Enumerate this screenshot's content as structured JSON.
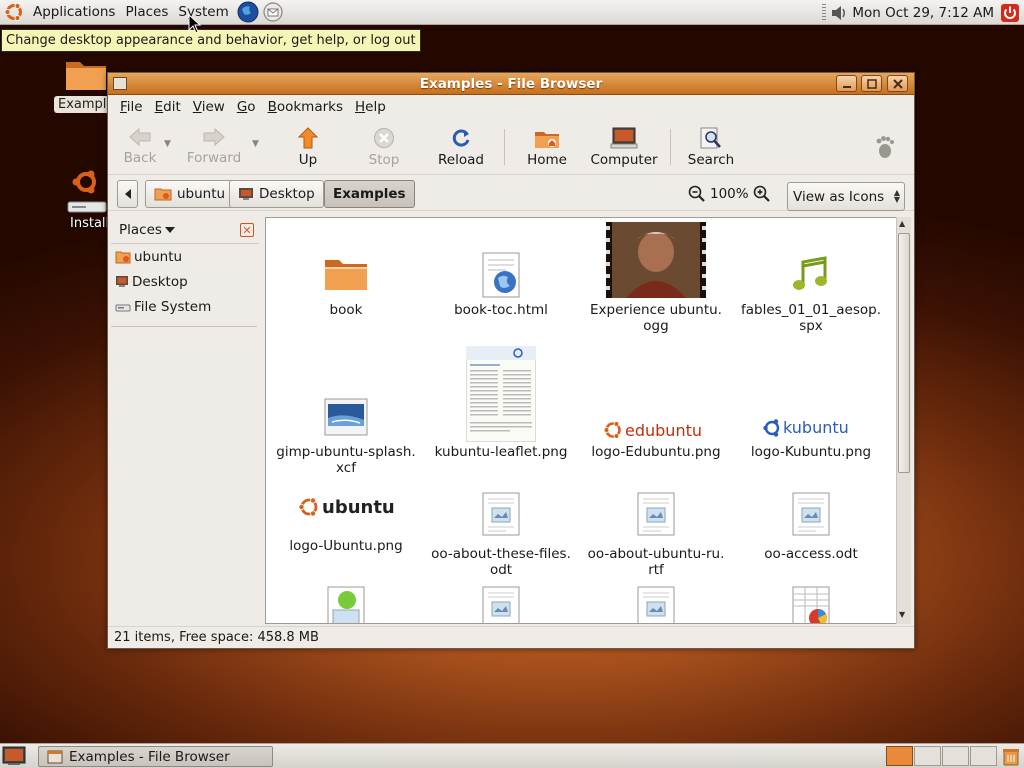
{
  "top_panel": {
    "menus": [
      "Applications",
      "Places",
      "System"
    ],
    "clock": "Mon Oct 29,  7:12 AM"
  },
  "tooltip": "Change desktop appearance and behavior, get help, or log out",
  "desktop": {
    "icons": [
      {
        "label": "Exampl"
      },
      {
        "label": "Install"
      }
    ]
  },
  "window": {
    "title": "Examples - File Browser",
    "menubar": [
      {
        "first": "F",
        "rest": "ile"
      },
      {
        "first": "E",
        "rest": "dit"
      },
      {
        "first": "V",
        "rest": "iew"
      },
      {
        "first": "G",
        "rest": "o"
      },
      {
        "first": "B",
        "rest": "ookmarks"
      },
      {
        "first": "H",
        "rest": "elp"
      }
    ],
    "toolbar": {
      "back": "Back",
      "forward": "Forward",
      "up": "Up",
      "stop": "Stop",
      "reload": "Reload",
      "home": "Home",
      "computer": "Computer",
      "search": "Search"
    },
    "location": {
      "path": [
        "ubuntu",
        "Desktop",
        "Examples"
      ],
      "zoom": "100%",
      "view_mode": "View as Icons"
    },
    "sidepane": {
      "title": "Places",
      "items": [
        "ubuntu",
        "Desktop",
        "File System"
      ]
    },
    "files": [
      {
        "line1": "book",
        "line2": ""
      },
      {
        "line1": "book-toc.html",
        "line2": ""
      },
      {
        "line1": "Experience ubuntu.",
        "line2": "ogg"
      },
      {
        "line1": "fables_01_01_aesop.",
        "line2": "spx"
      },
      {
        "line1": "gimp-ubuntu-splash.",
        "line2": "xcf"
      },
      {
        "line1": "kubuntu-leaflet.png",
        "line2": ""
      },
      {
        "line1": "logo-Edubuntu.png",
        "line2": ""
      },
      {
        "line1": "logo-Kubuntu.png",
        "line2": ""
      },
      {
        "line1": "logo-Ubuntu.png",
        "line2": ""
      },
      {
        "line1": "oo-about-these-files.",
        "line2": "odt"
      },
      {
        "line1": "oo-about-ubuntu-ru.",
        "line2": "rtf"
      },
      {
        "line1": "oo-access.odt",
        "line2": ""
      }
    ],
    "logo_text": {
      "edubuntu": "edubuntu",
      "kubuntu": "kubuntu",
      "ubuntu": "ubuntu"
    },
    "status": "21 items, Free space: 458.8 MB"
  },
  "bottom_panel": {
    "task": "Examples - File Browser",
    "workspaces": 4
  },
  "colors": {
    "accent": "#e07a2a",
    "titlebar": "#d07a2a",
    "panel": "#e8e5e0"
  }
}
